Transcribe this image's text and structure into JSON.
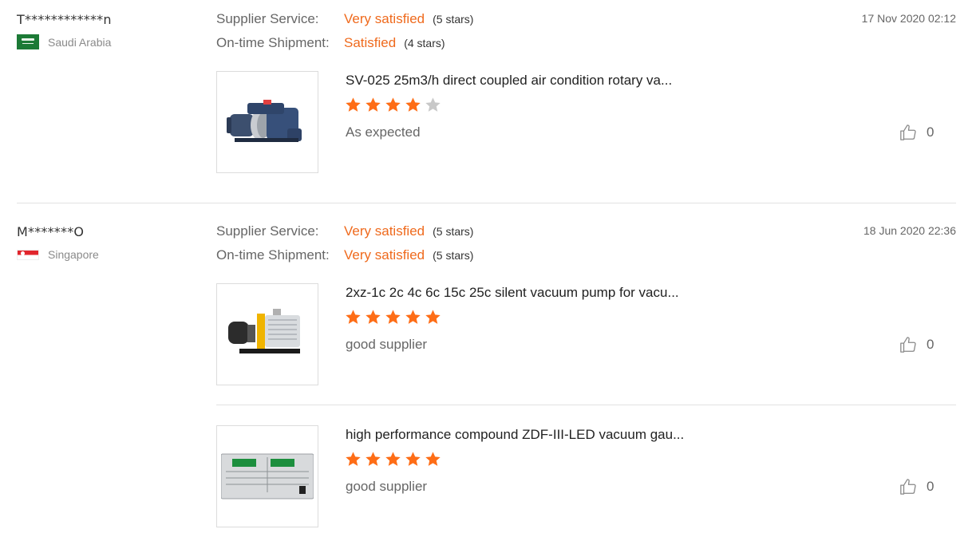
{
  "reviews": [
    {
      "user": "T************n",
      "country": "Saudi Arabia",
      "flag": "saudi-arabia-flag",
      "date": "17 Nov 2020 02:12",
      "supplier_service": {
        "label": "Supplier Service:",
        "value": "Very satisfied",
        "stars": "(5 stars)"
      },
      "shipment": {
        "label": "On-time Shipment:",
        "value": "Satisfied",
        "stars": "(4 stars)"
      },
      "products": [
        {
          "title": "SV-025 25m3/h direct coupled air condition rotary va...",
          "rating": 4,
          "comment": "As expected",
          "likes": "0",
          "image": "rotary-vane-pump-image"
        }
      ]
    },
    {
      "user": "M*******O",
      "country": "Singapore",
      "flag": "singapore-flag",
      "date": "18 Jun 2020 22:36",
      "supplier_service": {
        "label": "Supplier Service:",
        "value": "Very satisfied",
        "stars": "(5 stars)"
      },
      "shipment": {
        "label": "On-time Shipment:",
        "value": "Very satisfied",
        "stars": "(5 stars)"
      },
      "products": [
        {
          "title": "2xz-1c 2c 4c 6c 15c 25c silent vacuum pump for vacu...",
          "rating": 5,
          "comment": "good supplier",
          "likes": "0",
          "image": "two-stage-vacuum-pump-image"
        },
        {
          "title": "high performance compound ZDF-III-LED vacuum gau...",
          "rating": 5,
          "comment": "good supplier",
          "likes": "0",
          "image": "vacuum-gauge-controller-image"
        }
      ]
    }
  ],
  "colors": {
    "accent": "#ef6a1d",
    "star_filled": "#fe6d16",
    "star_empty": "#c8c8c8"
  }
}
